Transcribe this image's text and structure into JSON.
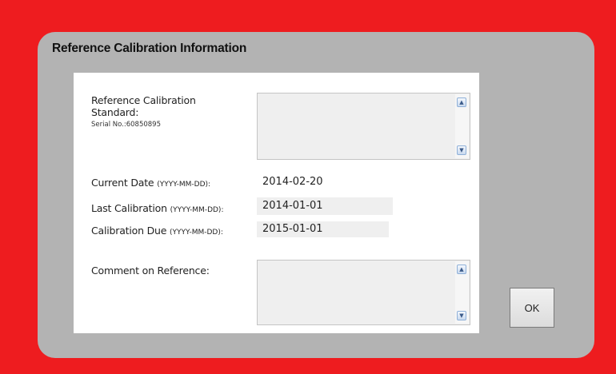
{
  "dialog": {
    "title": "Reference Calibration Information",
    "ok_label": "OK"
  },
  "reference": {
    "label_line1": "Reference Calibration",
    "label_line2": "Standard:",
    "serial": "Serial No.:60850895",
    "standard_value": ""
  },
  "current_date": {
    "label": "Current Date",
    "format": "(YYYY-MM-DD):",
    "value": "2014-02-20"
  },
  "last_calibration": {
    "label": "Last Calibration",
    "format": "(YYYY-MM-DD):",
    "value": "2014-01-01"
  },
  "calibration_due": {
    "label": "Calibration Due",
    "format": "(YYYY-MM-DD):",
    "value": "2015-01-01"
  },
  "comment": {
    "label": "Comment on Reference:",
    "value": ""
  },
  "icons": {
    "scroll_up": "chevron-up-icon",
    "scroll_down": "chevron-down-icon"
  },
  "colors": {
    "background": "#ee1c1f",
    "dialog": "#b3b3b3",
    "panel": "#ffffff",
    "field": "#efefef"
  }
}
